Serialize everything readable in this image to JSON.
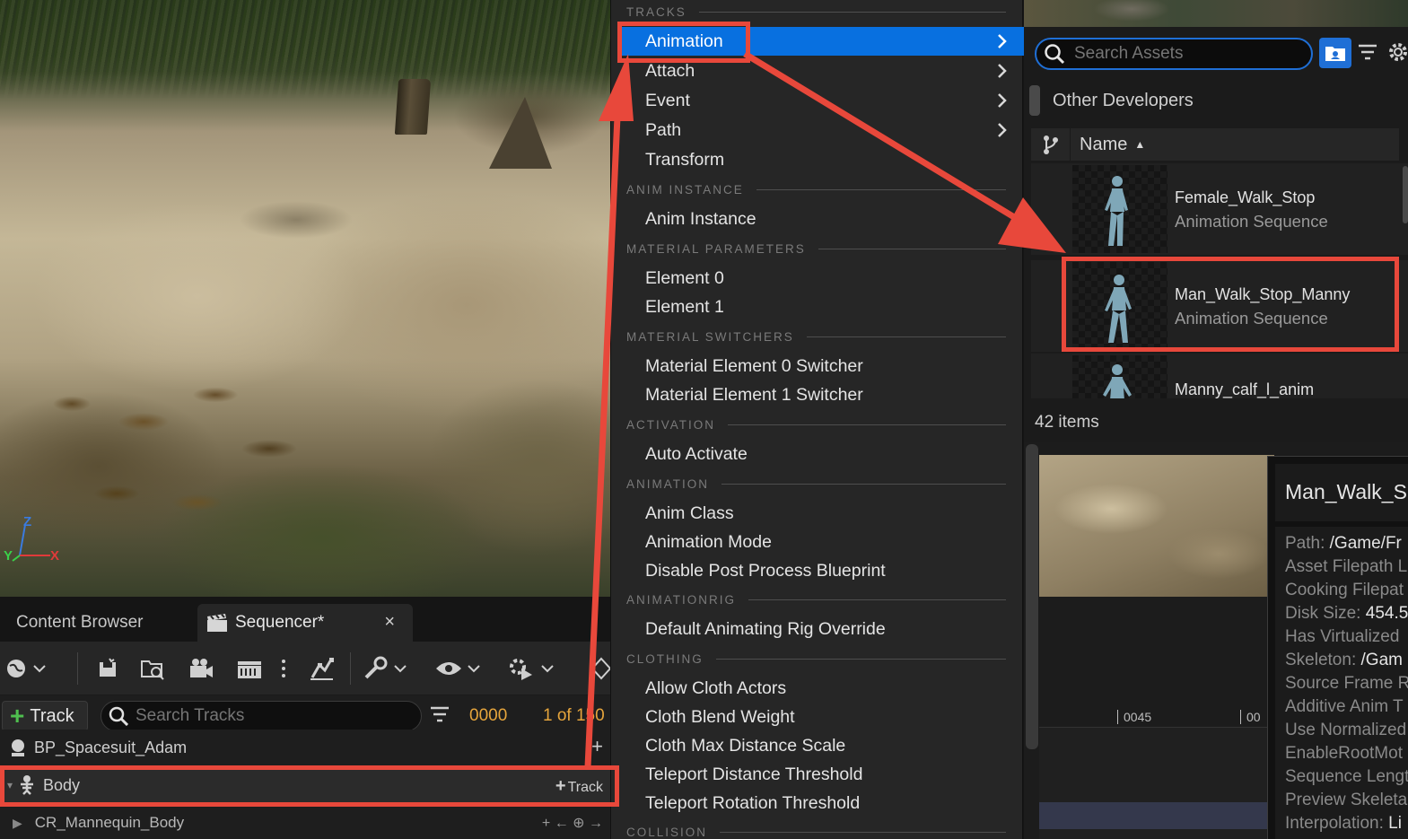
{
  "sequencer": {
    "tabs": [
      {
        "label": "Content Browser"
      },
      {
        "label": "Sequencer*"
      }
    ],
    "close_glyph": "×",
    "track_button": "Track",
    "search_placeholder": "Search Tracks",
    "frame_current": "0000",
    "frame_range": "1 of 150",
    "rows": [
      {
        "label": "BP_Spacesuit_Adam",
        "right": "+"
      },
      {
        "label": "Body",
        "right": "Track"
      },
      {
        "label": "CR_Mannequin_Body",
        "right": "+ ← ⊕ →"
      }
    ]
  },
  "viewport": {
    "axis_labels": {
      "z": "Z",
      "y": "Y",
      "x": "X"
    }
  },
  "menu": {
    "sections": [
      "TRACKS",
      "ANIM INSTANCE",
      "MATERIAL PARAMETERS",
      "MATERIAL SWITCHERS",
      "ACTIVATION",
      "ANIMATION",
      "ANIMATIONRIG",
      "CLOTHING",
      "COLLISION"
    ],
    "items": [
      "Animation",
      "Attach",
      "Event",
      "Path",
      "Transform",
      "Anim Instance",
      "Element 0",
      "Element 1",
      "Material Element 0 Switcher",
      "Material Element 1 Switcher",
      "Auto Activate",
      "Anim Class",
      "Animation Mode",
      "Disable Post Process Blueprint",
      "Default Animating Rig Override",
      "Allow Cloth Actors",
      "Cloth Blend Weight",
      "Cloth Max Distance Scale",
      "Teleport Distance Threshold",
      "Teleport Rotation Threshold"
    ]
  },
  "picker": {
    "search_placeholder": "Search Assets",
    "path": "Other Developers",
    "column_name": "Name",
    "sort_glyph": "▲",
    "assets": [
      {
        "name": "Female_Walk_Stop",
        "type": "Animation Sequence"
      },
      {
        "name": "Man_Walk_Stop_Manny",
        "type": "Animation Sequence"
      },
      {
        "name": "Manny_calf_l_anim",
        "type": ""
      }
    ],
    "count": "42 items"
  },
  "timeline": {
    "ticks": [
      "0045",
      "00"
    ]
  },
  "tooltip": {
    "title": "Man_Walk_S",
    "lines": [
      {
        "key": "Path:",
        "value": "/Game/Fr"
      },
      {
        "key": "Asset Filepath L",
        "value": ""
      },
      {
        "key": "Cooking Filepat",
        "value": ""
      },
      {
        "key": "Disk Size:",
        "value": "454.5"
      },
      {
        "key": "Has Virtualized",
        "value": ""
      },
      {
        "key": "Skeleton:",
        "value": "/Gam"
      },
      {
        "key": "Source Frame R",
        "value": ""
      },
      {
        "key": "Additive Anim T",
        "value": ""
      },
      {
        "key": "Use Normalized",
        "value": ""
      },
      {
        "key": "EnableRootMot",
        "value": ""
      },
      {
        "key": "Sequence Lengt",
        "value": ""
      },
      {
        "key": "Preview Skeleta",
        "value": ""
      },
      {
        "key": "Interpolation:",
        "value": "Li"
      }
    ]
  },
  "colors": {
    "highlight": "#0870e0",
    "annotation": "#e8483b",
    "frame_text": "#e6a53c",
    "add_green": "#4fbf4f"
  }
}
